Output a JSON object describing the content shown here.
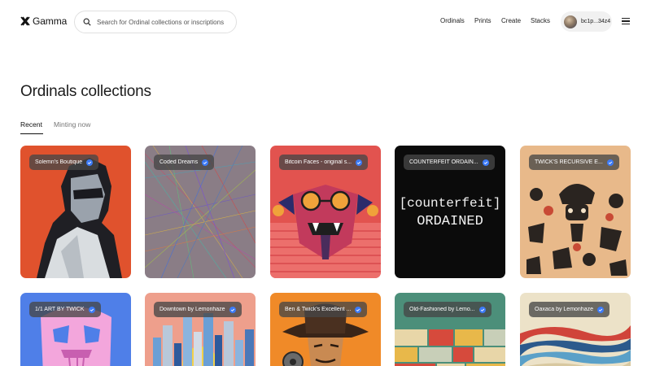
{
  "header": {
    "brand": "Gamma",
    "search_placeholder": "Search for Ordinal collections or inscriptions",
    "nav": [
      "Ordinals",
      "Prints",
      "Create",
      "Stacks"
    ],
    "wallet": "bc1p...34z4"
  },
  "page": {
    "title": "Ordinals collections",
    "tabs": [
      {
        "label": "Recent",
        "active": true
      },
      {
        "label": "Minting now",
        "active": false
      }
    ]
  },
  "collections": [
    {
      "name": "Solemn's Boutique",
      "verified": true
    },
    {
      "name": "Coded Dreams",
      "verified": true
    },
    {
      "name": "Bitcoin Faces - original s...",
      "verified": true
    },
    {
      "name": "COUNTERFEIT ORDAIN...",
      "verified": true,
      "art_text": [
        "[counterfeit]",
        "ORDAINED"
      ]
    },
    {
      "name": "TWICK'S RECURSIVE E...",
      "verified": true
    },
    {
      "name": "1/1 ART BY TWICK",
      "verified": true
    },
    {
      "name": "Downtown by Lemonhaze",
      "verified": true
    },
    {
      "name": "Ben & Twick's Excellent ...",
      "verified": true
    },
    {
      "name": "Old-Fashioned by Lemo...",
      "verified": true
    },
    {
      "name": "Oaxaca by Lemonhaze",
      "verified": true
    }
  ],
  "colors": {
    "verified_badge": "#3d7bf7",
    "badge_bg": "#464646"
  }
}
